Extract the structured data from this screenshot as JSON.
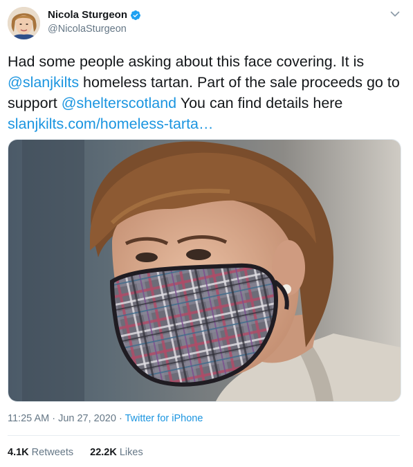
{
  "author": {
    "display_name": "Nicola Sturgeon",
    "handle": "@NicolaSturgeon",
    "verified_icon": "verified-badge-icon",
    "avatar_alt": "profile photo"
  },
  "tweet": {
    "segments": [
      {
        "type": "text",
        "value": "Had some people asking about this face covering. It is "
      },
      {
        "type": "link",
        "value": "@slanjkilts"
      },
      {
        "type": "text",
        "value": " homeless tartan. Part of the sale proceeds go to support "
      },
      {
        "type": "link",
        "value": "@shelterscotland"
      },
      {
        "type": "text",
        "value": " You can find details here "
      },
      {
        "type": "link",
        "value": "slanjkilts.com/homeless-tarta…"
      }
    ],
    "timestamp": "11:25 AM · Jun 27, 2020",
    "separator": " · ",
    "source": "Twitter for iPhone"
  },
  "stats": {
    "retweets_count": "4.1K",
    "retweets_label": "Retweets",
    "likes_count": "22.2K",
    "likes_label": "Likes"
  },
  "colors": {
    "link": "#1b95e0",
    "muted": "#657786",
    "text": "#14171a",
    "verified": "#1da1f2"
  }
}
